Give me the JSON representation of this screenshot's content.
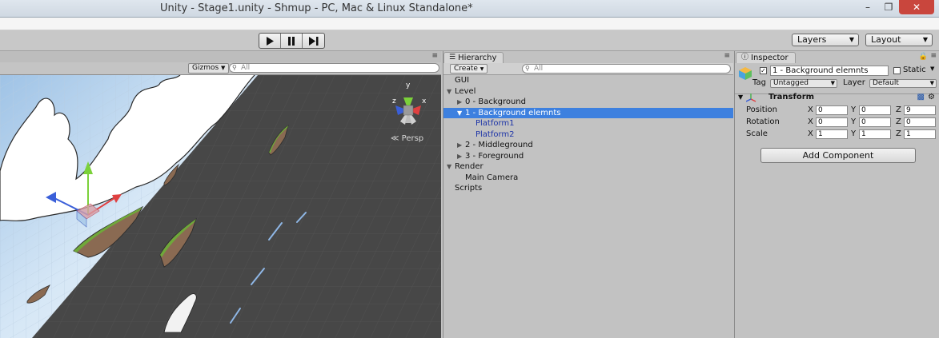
{
  "window": {
    "title": "Unity - Stage1.unity - Shmup - PC, Mac & Linux Standalone*",
    "minimize_icon": "minimize-icon",
    "maximize_icon": "restore-icon",
    "close_icon": "close-icon"
  },
  "toolbar": {
    "play_icon": "play-icon",
    "pause_icon": "pause-icon",
    "step_icon": "step-icon",
    "layers_label": "Layers",
    "layout_label": "Layout"
  },
  "scene": {
    "gizmos_label": "Gizmos",
    "search_placeholder": "All",
    "persp_label": "Persp",
    "gizmo_axes": [
      "y",
      "x",
      "z"
    ]
  },
  "hierarchy": {
    "tab_label": "Hierarchy",
    "create_label": "Create",
    "search_placeholder": "All",
    "items": [
      {
        "label": "GUI",
        "depth": 0,
        "arrow": "",
        "selected": false,
        "prefab": false
      },
      {
        "label": "Level",
        "depth": 0,
        "arrow": "down",
        "selected": false,
        "prefab": false
      },
      {
        "label": "0 - Background",
        "depth": 1,
        "arrow": "right",
        "selected": false,
        "prefab": false
      },
      {
        "label": "1 - Background elemnts",
        "depth": 1,
        "arrow": "down",
        "selected": true,
        "prefab": false
      },
      {
        "label": "Platform1",
        "depth": 2,
        "arrow": "",
        "selected": false,
        "prefab": true
      },
      {
        "label": "Platform2",
        "depth": 2,
        "arrow": "",
        "selected": false,
        "prefab": true
      },
      {
        "label": "2 - Middleground",
        "depth": 1,
        "arrow": "right",
        "selected": false,
        "prefab": false
      },
      {
        "label": "3 - Foreground",
        "depth": 1,
        "arrow": "right",
        "selected": false,
        "prefab": false
      },
      {
        "label": "Render",
        "depth": 0,
        "arrow": "down",
        "selected": false,
        "prefab": false
      },
      {
        "label": "Main Camera",
        "depth": 1,
        "arrow": "",
        "selected": false,
        "prefab": false
      },
      {
        "label": "Scripts",
        "depth": 0,
        "arrow": "",
        "selected": false,
        "prefab": false
      }
    ]
  },
  "inspector": {
    "tab_label": "Inspector",
    "object_name": "1 - Background elemnts",
    "active": true,
    "static_label": "Static",
    "tag_label": "Tag",
    "tag_value": "Untagged",
    "layer_label": "Layer",
    "layer_value": "Default",
    "transform": {
      "title": "Transform",
      "rows": [
        {
          "label": "Position",
          "x": "0",
          "y": "0",
          "z": "9"
        },
        {
          "label": "Rotation",
          "x": "0",
          "y": "0",
          "z": "0"
        },
        {
          "label": "Scale",
          "x": "1",
          "y": "1",
          "z": "1"
        }
      ]
    },
    "add_component_label": "Add Component"
  },
  "colors": {
    "selection": "#3d80df",
    "prefab_text": "#1d34a8",
    "scene_bg": "#474747",
    "panel_bg": "#c2c2c2"
  }
}
